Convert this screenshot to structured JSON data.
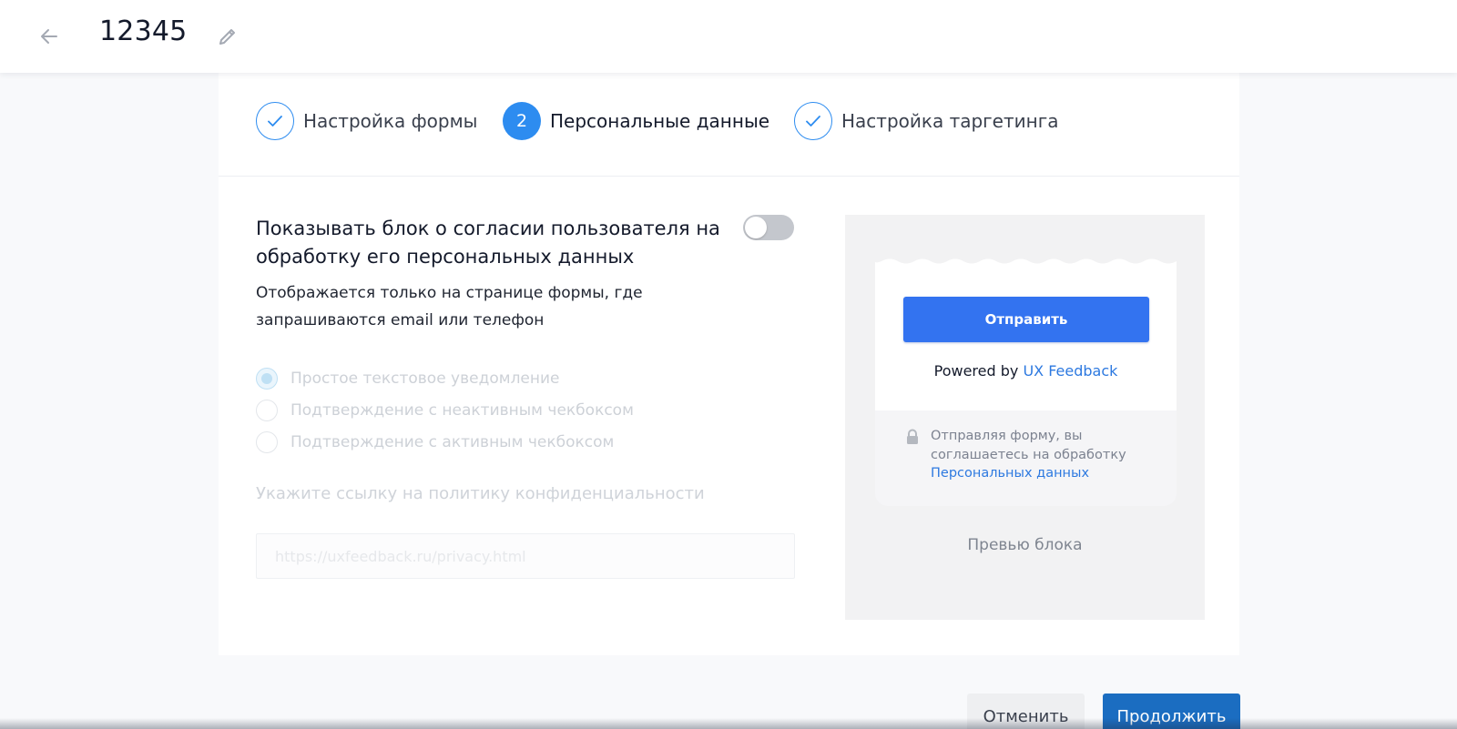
{
  "header": {
    "title": "12345",
    "back_icon": "arrow-left-icon",
    "edit_icon": "pencil-icon"
  },
  "steps": [
    {
      "label": "Настройка формы",
      "state": "done",
      "icon": "check-icon"
    },
    {
      "label": "Персональные данные",
      "state": "active",
      "number": "2"
    },
    {
      "label": "Настройка таргетинга",
      "state": "done",
      "icon": "check-icon"
    }
  ],
  "consent": {
    "title": "Показывать блок о согласии пользователя на обработку его персональных данных",
    "toggle_on": false,
    "description": "Отображается только на странице формы, где запрашиваются email или телефон",
    "options": [
      {
        "label": "Простое текстовое уведомление",
        "checked": true
      },
      {
        "label": "Подтверждение с неактивным чекбоксом",
        "checked": false
      },
      {
        "label": "Подтверждение с активным чекбоксом",
        "checked": false
      }
    ],
    "policy_label": "Укажите ссылку на политику конфиденциальности",
    "policy_placeholder": "https://uxfeedback.ru/privacy.html"
  },
  "preview": {
    "submit_label": "Отправить",
    "powered_by": "Powered by",
    "powered_link": "UX Feedback",
    "consent_text": "Отправляя форму, вы соглашаетесь на обработку",
    "consent_link": "Персональных данных",
    "caption": "Превью блока",
    "lock_icon": "lock-icon"
  },
  "footer": {
    "cancel_label": "Отменить",
    "continue_label": "Продолжить"
  },
  "colors": {
    "accent": "#2d8cf0",
    "submit_button": "#3373f0",
    "continue_button": "#1b6dc1",
    "link": "#2d79e0"
  }
}
